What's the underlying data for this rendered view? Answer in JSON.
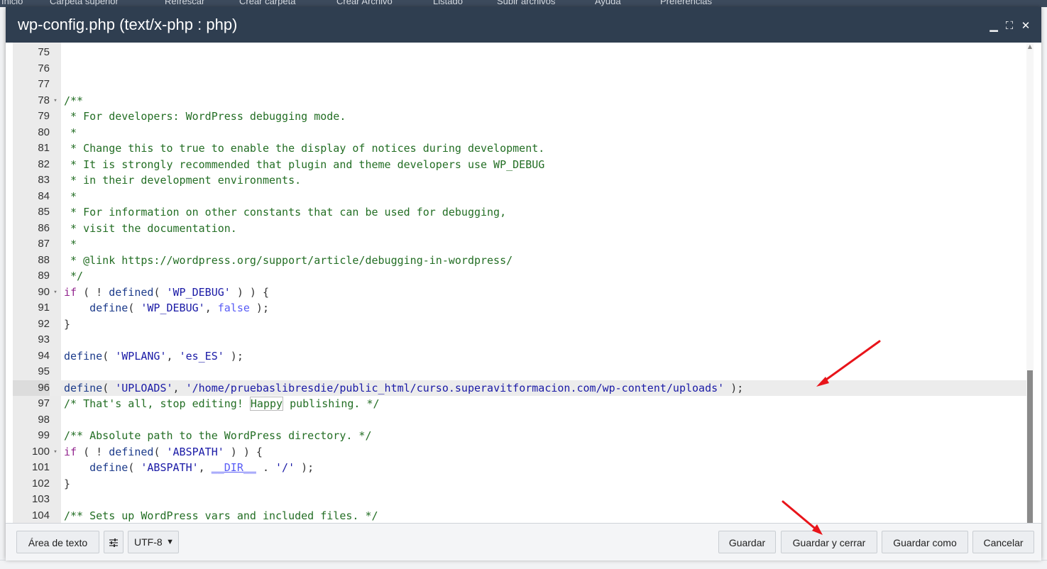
{
  "background": {
    "toolbar_items": [
      "Inicio",
      "Carpeta superior",
      "Refrescar",
      "Crear carpeta",
      "Crear Archivo",
      "Listado",
      "Subir archivos",
      "Ayuda",
      "Preferencias"
    ]
  },
  "dialog": {
    "title": "wp-config.php (text/x-php : php)",
    "controls": {
      "minimize": "▁",
      "maximize": "⛶",
      "close": "✕"
    }
  },
  "editor": {
    "active_line": 96,
    "lines": [
      {
        "n": "75",
        "fold": ""
      },
      {
        "n": "76",
        "fold": ""
      },
      {
        "n": "77",
        "fold": ""
      },
      {
        "n": "78",
        "fold": "▾"
      },
      {
        "n": "79",
        "fold": ""
      },
      {
        "n": "80",
        "fold": ""
      },
      {
        "n": "81",
        "fold": ""
      },
      {
        "n": "82",
        "fold": ""
      },
      {
        "n": "83",
        "fold": ""
      },
      {
        "n": "84",
        "fold": ""
      },
      {
        "n": "85",
        "fold": ""
      },
      {
        "n": "86",
        "fold": ""
      },
      {
        "n": "87",
        "fold": ""
      },
      {
        "n": "88",
        "fold": ""
      },
      {
        "n": "89",
        "fold": ""
      },
      {
        "n": "90",
        "fold": "▾"
      },
      {
        "n": "91",
        "fold": ""
      },
      {
        "n": "92",
        "fold": ""
      },
      {
        "n": "93",
        "fold": ""
      },
      {
        "n": "94",
        "fold": ""
      },
      {
        "n": "95",
        "fold": ""
      },
      {
        "n": "96",
        "fold": ""
      },
      {
        "n": "97",
        "fold": ""
      },
      {
        "n": "98",
        "fold": ""
      },
      {
        "n": "99",
        "fold": ""
      },
      {
        "n": "100",
        "fold": "▾"
      },
      {
        "n": "101",
        "fold": ""
      },
      {
        "n": "102",
        "fold": ""
      },
      {
        "n": "103",
        "fold": ""
      },
      {
        "n": "104",
        "fold": ""
      }
    ],
    "code": {
      "l78": "/**",
      "l79": " * For developers: WordPress debugging mode.",
      "l80": " *",
      "l81": " * Change this to true to enable the display of notices during development.",
      "l82": " * It is strongly recommended that plugin and theme developers use WP_DEBUG",
      "l83": " * in their development environments.",
      "l84": " *",
      "l85": " * For information on other constants that can be used for debugging,",
      "l86": " * visit the documentation.",
      "l87": " *",
      "l88": " * @link https://wordpress.org/support/article/debugging-in-wordpress/",
      "l89": " */",
      "l90_kw": "if",
      "l90_a": " ( ! ",
      "l90_fn": "defined",
      "l90_b": "( ",
      "l90_str": "'WP_DEBUG'",
      "l90_c": " ) ) {",
      "l91_a": "    ",
      "l91_fn": "define",
      "l91_b": "( ",
      "l91_str": "'WP_DEBUG'",
      "l91_c": ", ",
      "l91_const": "false",
      "l91_d": " );",
      "l92": "}",
      "l94_fn": "define",
      "l94_a": "( ",
      "l94_str1": "'WPLANG'",
      "l94_b": ", ",
      "l94_str2": "'es_ES'",
      "l94_c": " );",
      "l96_fn": "define",
      "l96_a": "( ",
      "l96_str1": "'UPLOADS'",
      "l96_b": ", ",
      "l96_str2": "'/home/pruebaslibresdie/public_html/curso.superavitformacion.com/wp-content/uploads'",
      "l96_c": " );",
      "l97_a": "/* That's all, stop editing! ",
      "l97_hl": "Happy",
      "l97_b": " publishing. */",
      "l99": "/** Absolute path to the WordPress directory. */",
      "l100_kw": "if",
      "l100_a": " ( ! ",
      "l100_fn": "defined",
      "l100_b": "( ",
      "l100_str": "'ABSPATH'",
      "l100_c": " ) ) {",
      "l101_a": "    ",
      "l101_fn": "define",
      "l101_b": "( ",
      "l101_str1": "'ABSPATH'",
      "l101_c": ", ",
      "l101_magic": "__DIR__",
      "l101_d": " . ",
      "l101_str2": "'/'",
      "l101_e": " );",
      "l102": "}",
      "l104": "/** Sets up WordPress vars and included files. */"
    }
  },
  "footer": {
    "text_area_label": "Área de texto",
    "settings_icon": "sliders-icon",
    "encoding_value": "UTF-8",
    "save_label": "Guardar",
    "save_close_label": "Guardar y cerrar",
    "save_as_label": "Guardar como",
    "cancel_label": "Cancelar"
  },
  "annotations": {
    "arrow_color": "#e8141a"
  }
}
